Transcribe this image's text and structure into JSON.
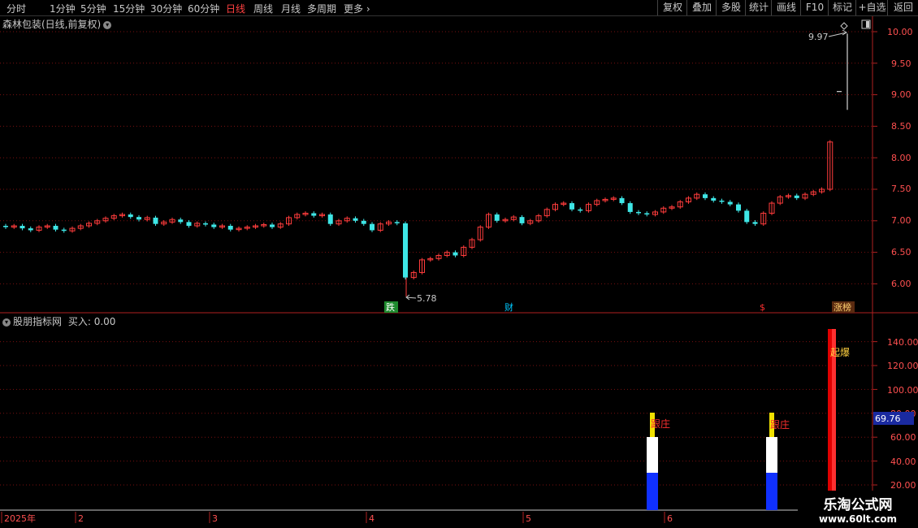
{
  "toolbar": {
    "periods": [
      "分时",
      "1分钟",
      "5分钟",
      "15分钟",
      "30分钟",
      "60分钟",
      "日线",
      "周线",
      "月线",
      "多周期",
      "更多"
    ],
    "active_index": 6,
    "right_buttons": [
      "复权",
      "叠加",
      "多股",
      "统计",
      "画线",
      "F10",
      "标记",
      "+自选",
      "返回"
    ]
  },
  "main_panel": {
    "title": "森林包装(日线,前复权)",
    "high_label": "9.97",
    "low_label": "5.78",
    "markers": [
      {
        "text": "跌",
        "bg": "#1e8a2e",
        "fg": "#ffffff"
      },
      {
        "text": "财",
        "bg": "#000000",
        "fg": "#00c8ff"
      },
      {
        "text": "$",
        "bg": "#000000",
        "fg": "#ff3030"
      },
      {
        "text": "涨榜",
        "bg": "#5a2a10",
        "fg": "#ffd070"
      }
    ],
    "y_ticks": [
      "10.00",
      "9.50",
      "9.00",
      "8.50",
      "8.00",
      "7.50",
      "7.00",
      "6.50",
      "6.00"
    ]
  },
  "indicator_panel": {
    "title": "股朋指标网",
    "buy_label": "买入:",
    "buy_value": "0.00",
    "current_value": "69.76",
    "y_ticks": [
      "140.00",
      "120.00",
      "100.00",
      "80.00",
      "60.00",
      "40.00",
      "20.00"
    ],
    "signal_labels": [
      "跟庄",
      "跟庄",
      "起爆"
    ]
  },
  "time_axis": {
    "labels": [
      "2025年",
      "2",
      "3",
      "4",
      "5",
      "6"
    ]
  },
  "watermark": {
    "line1": "乐淘公式网",
    "line2": "www.60lt.com"
  },
  "colors": {
    "up": "#ff3c3c",
    "down": "#3ee6e6",
    "grid": "#7a1010",
    "axis": "#b02020",
    "active": "#ff4040",
    "value_box": "#1a2aa0"
  }
}
